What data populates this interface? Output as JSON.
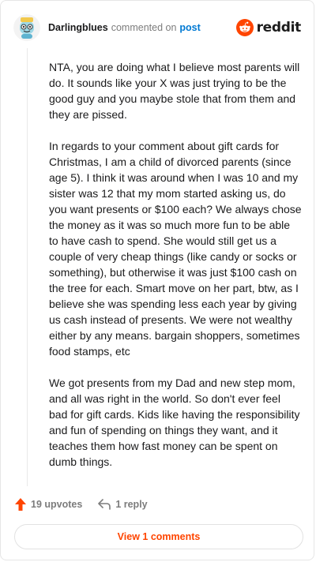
{
  "header": {
    "username": "Darlingblues",
    "action_text": "commented on",
    "post_link": "post",
    "brand": "reddit",
    "avatar_icon": "snoo-avatar-icon",
    "brand_icon": "reddit-alien-icon",
    "accent_color": "#ff4500"
  },
  "comment": {
    "paragraphs": [
      "NTA, you are doing what I believe most parents will do. It sounds like your X was just trying to be the good guy and you maybe stole that from them and they are pissed.",
      "In regards to your comment about gift cards for Christmas, I am a child of divorced parents (since age 5). I think it was around when I was 10 and my sister was 12 that my mom started asking us, do you want presents or $100 each? We always chose the money as it was so much more fun to be able to have cash to spend. She would still get us a couple of very cheap things (like candy or socks or something), but otherwise it was just $100 cash on the tree for each. Smart move on her part, btw, as I believe she was spending less each year by giving us cash instead of presents. We were not wealthy either by any means. bargain shoppers, sometimes food stamps, etc",
      "We got presents from my Dad and new step mom, and all was right in the world. So don't ever feel bad for gift cards. Kids like having the responsibility and fun of spending on things they want, and it teaches them how fast money can be spent on dumb things."
    ]
  },
  "footer": {
    "upvotes": "19 upvotes",
    "replies": "1 reply",
    "upvote_icon": "upvote-arrow-icon",
    "reply_icon": "reply-arrow-icon",
    "view_comments": "View 1 comments"
  }
}
